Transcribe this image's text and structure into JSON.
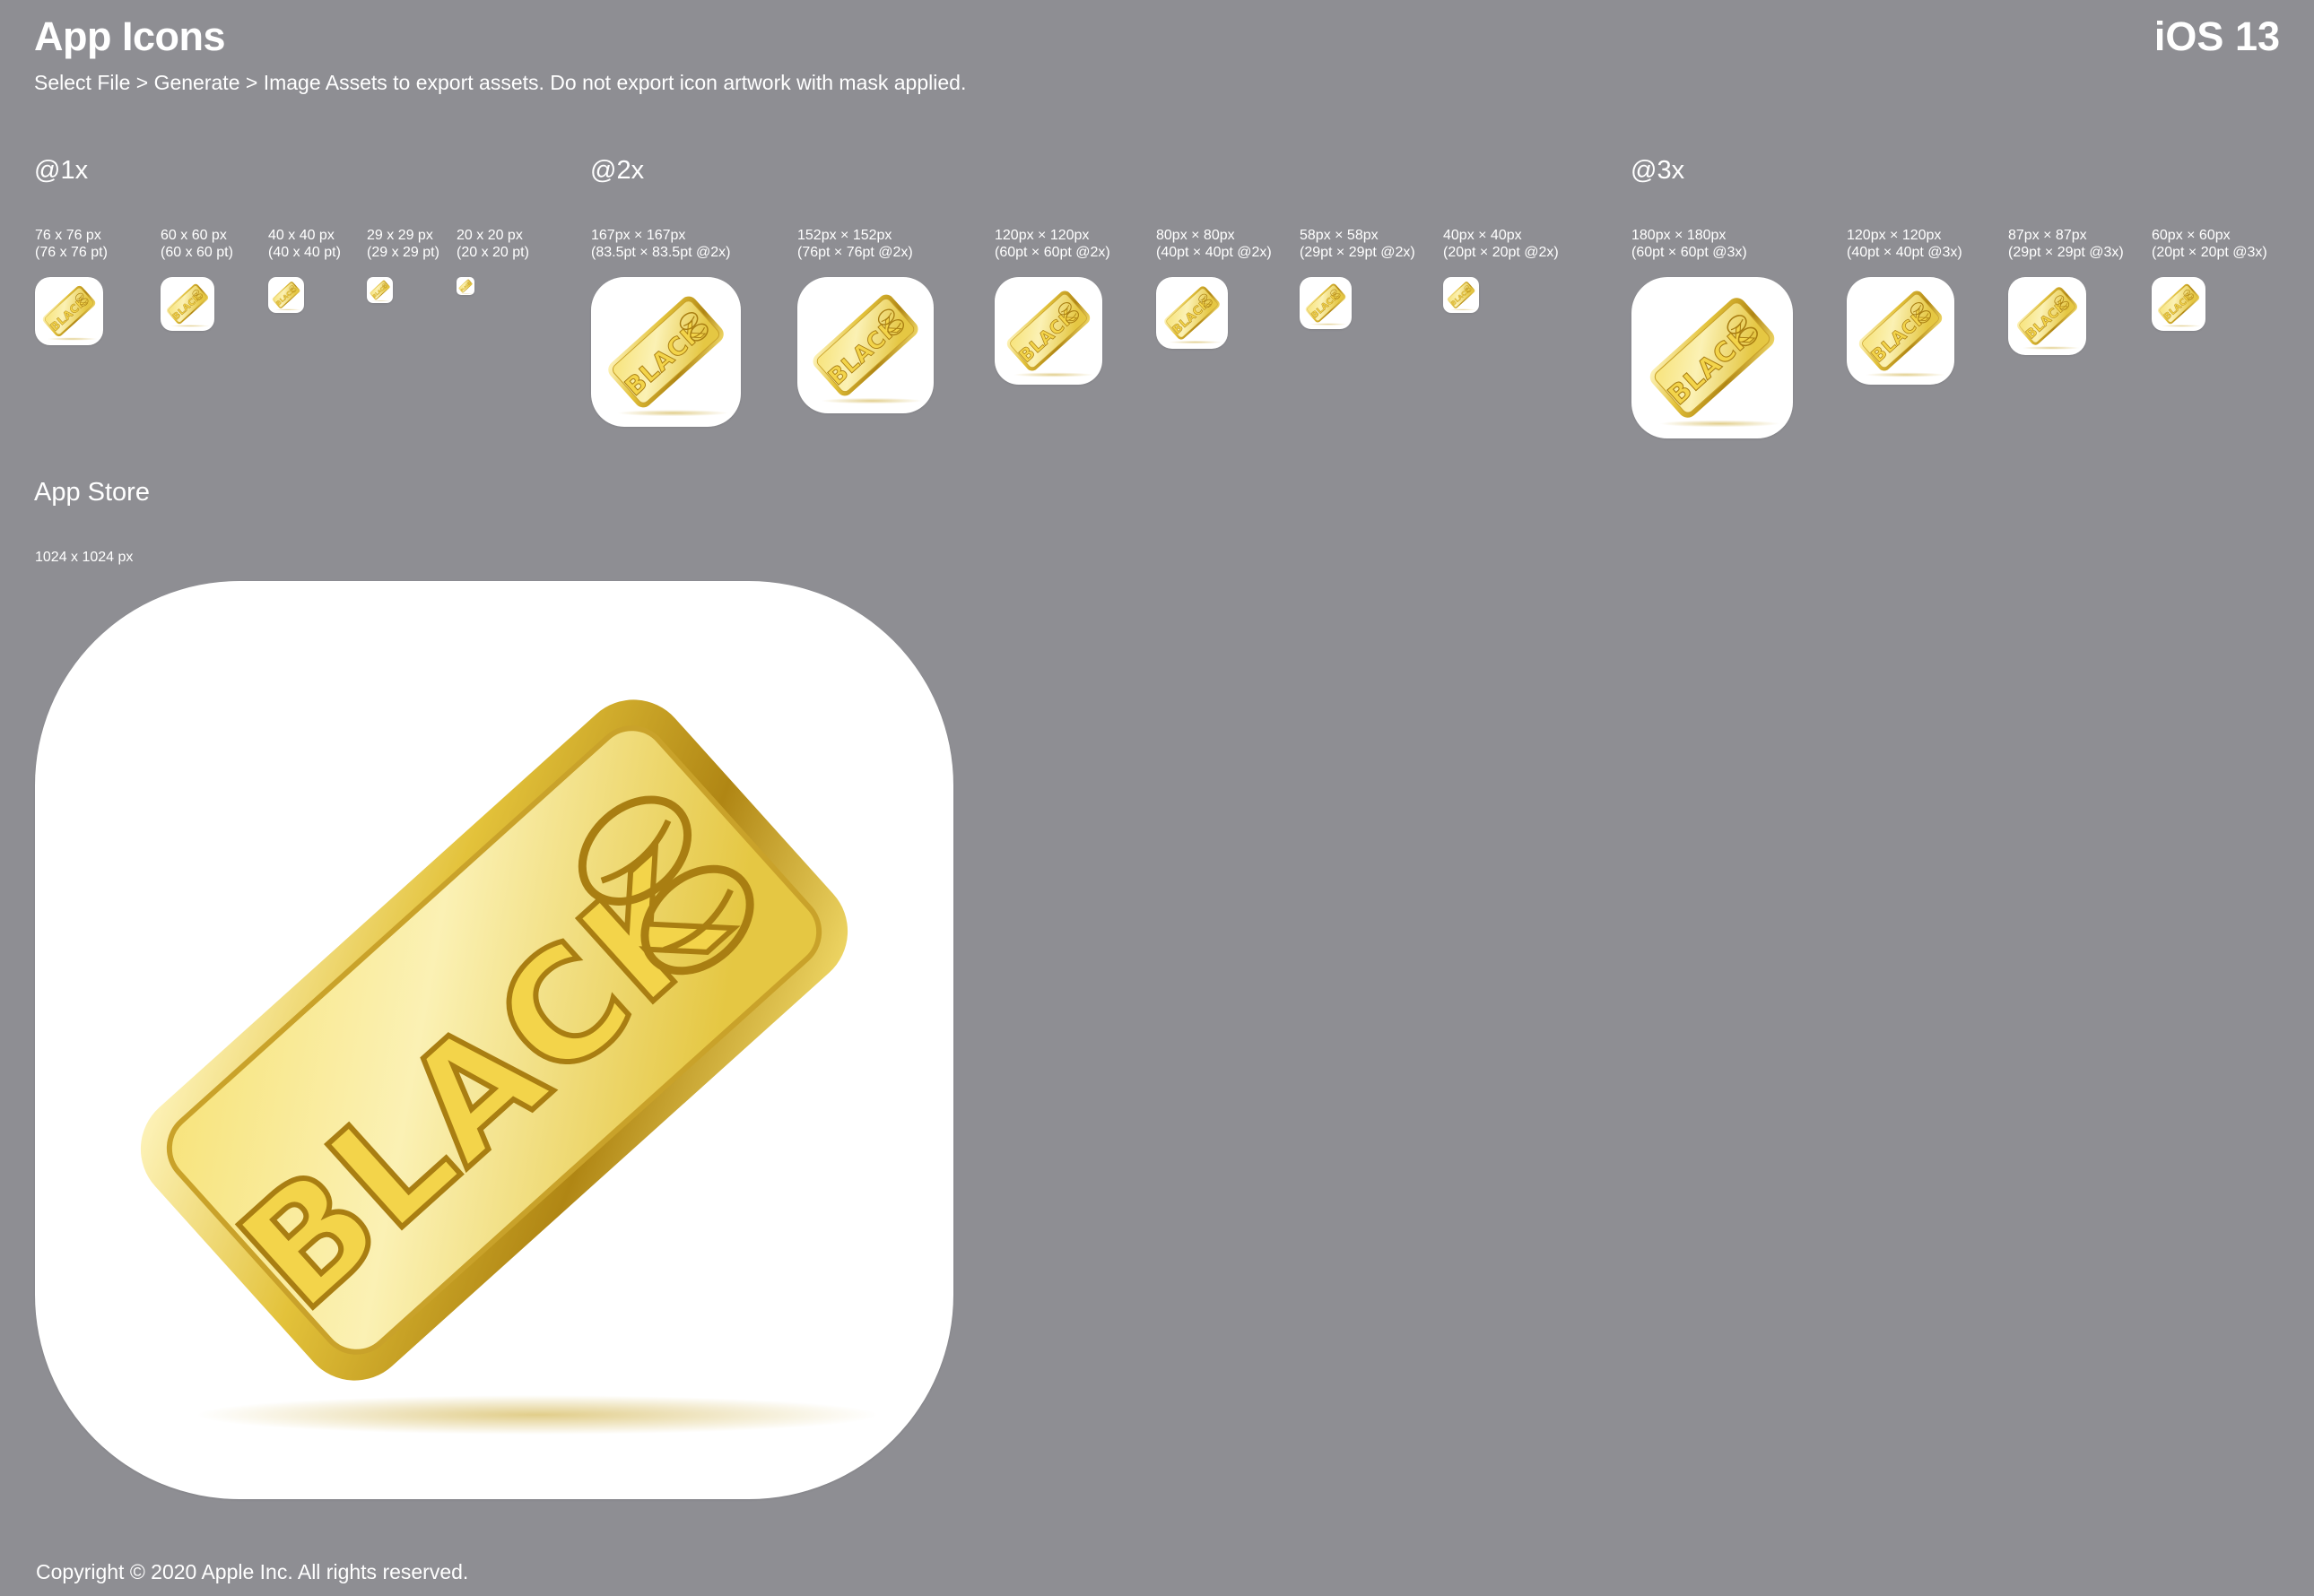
{
  "header": {
    "title": "App Icons",
    "platform": "iOS 13",
    "instructions": "Select File > Generate > Image Assets to export assets. Do not export icon artwork with mask applied."
  },
  "sections": {
    "x1": {
      "heading": "@1x",
      "icons": [
        {
          "px": "76 x 76 px",
          "pt": "(76 x 76 pt)"
        },
        {
          "px": "60 x 60 px",
          "pt": "(60 x 60 pt)"
        },
        {
          "px": "40 x 40 px",
          "pt": "(40 x 40 pt)"
        },
        {
          "px": "29 x 29 px",
          "pt": "(29 x 29 pt)"
        },
        {
          "px": "20 x 20 px",
          "pt": "(20 x 20 pt)"
        }
      ]
    },
    "x2": {
      "heading": "@2x",
      "icons": [
        {
          "px": "167px × 167px",
          "pt": "(83.5pt × 83.5pt @2x)"
        },
        {
          "px": "152px × 152px",
          "pt": "(76pt × 76pt @2x)"
        },
        {
          "px": "120px × 120px",
          "pt": "(60pt × 60pt @2x)"
        },
        {
          "px": "80px × 80px",
          "pt": "(40pt × 40pt @2x)"
        },
        {
          "px": "58px × 58px",
          "pt": "(29pt × 29pt @2x)"
        },
        {
          "px": "40px × 40px",
          "pt": "(20pt × 20pt @2x)"
        }
      ]
    },
    "x3": {
      "heading": "@3x",
      "icons": [
        {
          "px": "180px × 180px",
          "pt": "(60pt × 60pt @3x)"
        },
        {
          "px": "120px × 120px",
          "pt": "(40pt × 40pt @3x)"
        },
        {
          "px": "87px × 87px",
          "pt": "(29pt × 29pt @3x)"
        },
        {
          "px": "60px × 60px",
          "pt": "(20pt × 20pt @3x)"
        }
      ]
    },
    "app_store": {
      "heading": "App Store",
      "size": "1024 x 1024 px"
    }
  },
  "artwork": {
    "text": "BLACK",
    "description_icon": "gold-bar-icon",
    "colors": {
      "background": "#8e8e93",
      "icon_bg": "#ffffff",
      "gold_light": "#fbf0a8",
      "gold_mid": "#e6c83a",
      "gold_dark": "#a67c12",
      "engraving": "#b48a12"
    }
  },
  "footer": {
    "copyright": "Copyright © 2020 Apple Inc. All rights reserved."
  }
}
